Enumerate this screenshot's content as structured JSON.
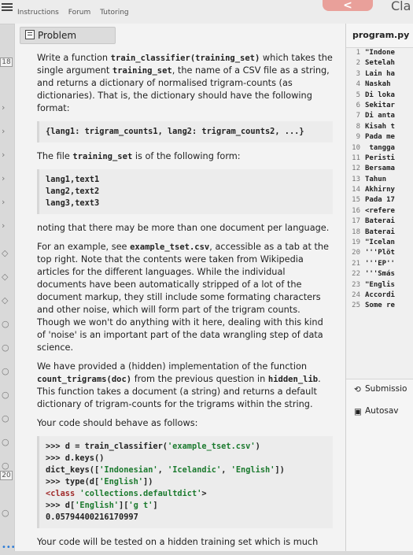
{
  "topbar": {
    "tabs": [
      "Instructions",
      "Forum",
      "Tutoring"
    ],
    "prev_label": "<",
    "cla_label": "Cla"
  },
  "gutter": {
    "numbers": [
      {
        "label": "18"
      },
      {
        "label": "20"
      }
    ]
  },
  "problem": {
    "header_label": "Problem",
    "para1_a": "Write a function ",
    "para1_fn": "train_classifier(training_set)",
    "para1_b": " which takes the single argument ",
    "para1_arg": "training_set",
    "para1_c": ", the name of a CSV file as a string, and returns a dictionary of normalised trigram-counts (as dictionaries). That is, the dictionary should have the following format:",
    "dict_format": "{lang1: trigram_counts1, lang2: trigram_counts2, ...}",
    "para2_a": "The file ",
    "para2_code": "training_set",
    "para2_b": " is of the following form:",
    "file_form": "lang1,text1\nlang2,text2\nlang3,text3",
    "para3": "noting that there may be more than one document per language.",
    "para4_a": "For an example, see ",
    "para4_code": "example_tset.csv",
    "para4_b": ", accessible as a tab at the top right. Note that the contents were taken from Wikipedia articles for the different languages. While the individual documents have been automatically stripped of a lot of the document markup, they still include some formating characters and other noise, which will form part of the trigram counts. Though we won't do anything with it here, dealing with this kind of 'noise' is an important part of the data wrangling step of data science.",
    "para5_a": "We have provided a (hidden) implementation of the function ",
    "para5_code1": "count_trigrams(doc)",
    "para5_b": " from the previous question in ",
    "para5_code2": "hidden_lib",
    "para5_c": ". This function takes a document (a string) and returns a default dictionary of trigram-counts for the trigrams within the string.",
    "para6": "Your code should behave as follows:",
    "example": {
      "l1_prompt": ">>> d = train_classifier(",
      "l1_str": "'example_tset.csv'",
      "l1_end": ")",
      "l2": ">>> d.keys()",
      "l3_a": "dict_keys([",
      "l3_s1": "'Indonesian'",
      "l3_s2": "'Icelandic'",
      "l3_s3": "'English'",
      "l3_end": "])",
      "l4_a": ">>> type(d[",
      "l4_s": "'English'",
      "l4_end": "])",
      "l5_kw": "<class",
      "l5_s": "'collections.defaultdict'",
      "l5_end": ">",
      "l6_a": ">>> d[",
      "l6_s1": "'English'",
      "l6_mid": "][",
      "l6_s2": "'g t'",
      "l6_end": "]",
      "l7": "0.05794400216170997"
    },
    "para7": "Your code will be tested on a hidden training set which is much"
  },
  "editor": {
    "filename": "program.py",
    "lines": [
      {
        "n": "1",
        "t": "\"Indone"
      },
      {
        "n": "2",
        "t": "Setelah"
      },
      {
        "n": "3",
        "t": "Lain ha"
      },
      {
        "n": "4",
        "t": "Naskah"
      },
      {
        "n": "5",
        "t": "Di loka"
      },
      {
        "n": "6",
        "t": "Sekitar"
      },
      {
        "n": "7",
        "t": "Di anta"
      },
      {
        "n": "8",
        "t": "Kisah t"
      },
      {
        "n": "9",
        "t": "Pada me"
      },
      {
        "n": "10",
        "t": " tangga"
      },
      {
        "n": "11",
        "t": "Peristi"
      },
      {
        "n": "12",
        "t": "Bersama"
      },
      {
        "n": "13",
        "t": "Tahun"
      },
      {
        "n": "14",
        "t": "Akhirny"
      },
      {
        "n": "15",
        "t": "Pada 17"
      },
      {
        "n": "16",
        "t": "<refere"
      },
      {
        "n": "17",
        "t": "Baterai"
      },
      {
        "n": "18",
        "t": "Baterai"
      },
      {
        "n": "19",
        "t": "\"Icelan"
      },
      {
        "n": "20",
        "t": "'''Plöt"
      },
      {
        "n": "21",
        "t": "'''EP''"
      },
      {
        "n": "22",
        "t": "'''Smás"
      },
      {
        "n": "23",
        "t": "\"Englis"
      },
      {
        "n": "24",
        "t": "Accordi"
      },
      {
        "n": "25",
        "t": "Some re"
      }
    ],
    "submit_label": "Submissio",
    "autosave_label": "Autosav"
  }
}
